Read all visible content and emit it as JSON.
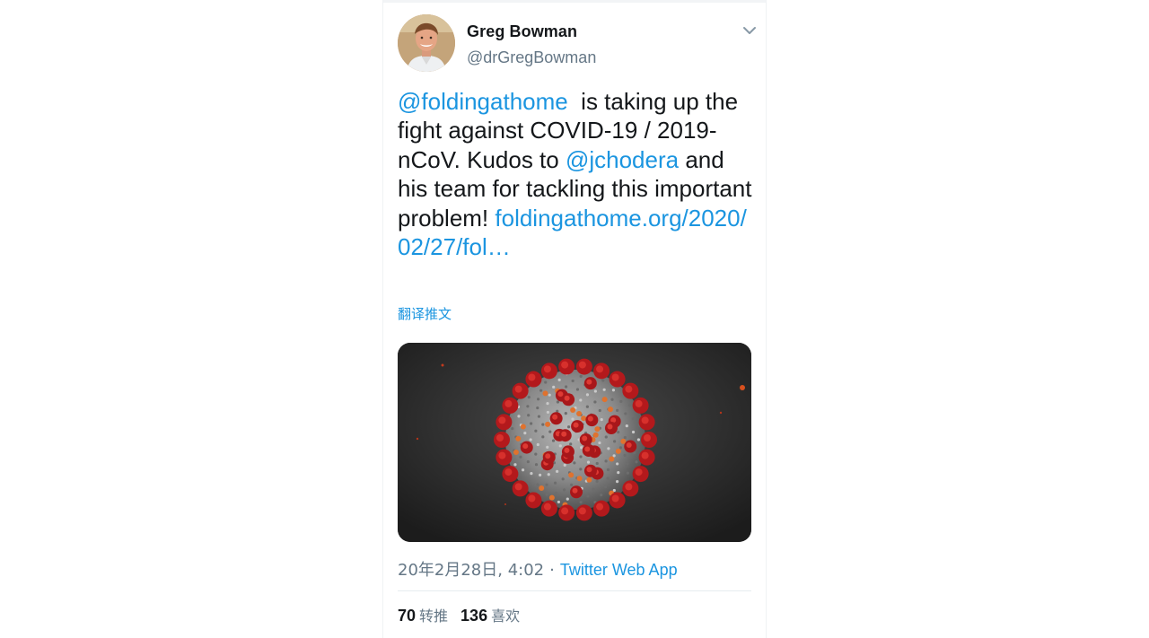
{
  "tweet": {
    "author": {
      "display_name": "Greg Bowman",
      "handle": "@drGregBowman"
    },
    "text_parts": [
      {
        "type": "mention",
        "text": "@foldingathome"
      },
      {
        "type": "text",
        "text": "  is taking up the fight against COVID-19 / 2019-nCoV. Kudos to "
      },
      {
        "type": "mention",
        "text": "@jchodera"
      },
      {
        "type": "text",
        "text": " and his team for tackling this important problem! "
      },
      {
        "type": "link",
        "text": "foldingathome.org/2020/02/27/fol…"
      }
    ],
    "translate_label": "翻译推文",
    "timestamp": "20年2月28日, 4:02",
    "separator": "·",
    "source": "Twitter Web App",
    "stats": {
      "retweets_count": "70",
      "retweets_label": "转推",
      "likes_count": "136",
      "likes_label": "喜欢"
    }
  },
  "colors": {
    "link": "#1b95e0",
    "secondary_text": "#657786",
    "primary_text": "#14171a",
    "divider": "#e6ecf0"
  },
  "icons": {
    "menu_caret": "chevron-down-icon"
  }
}
